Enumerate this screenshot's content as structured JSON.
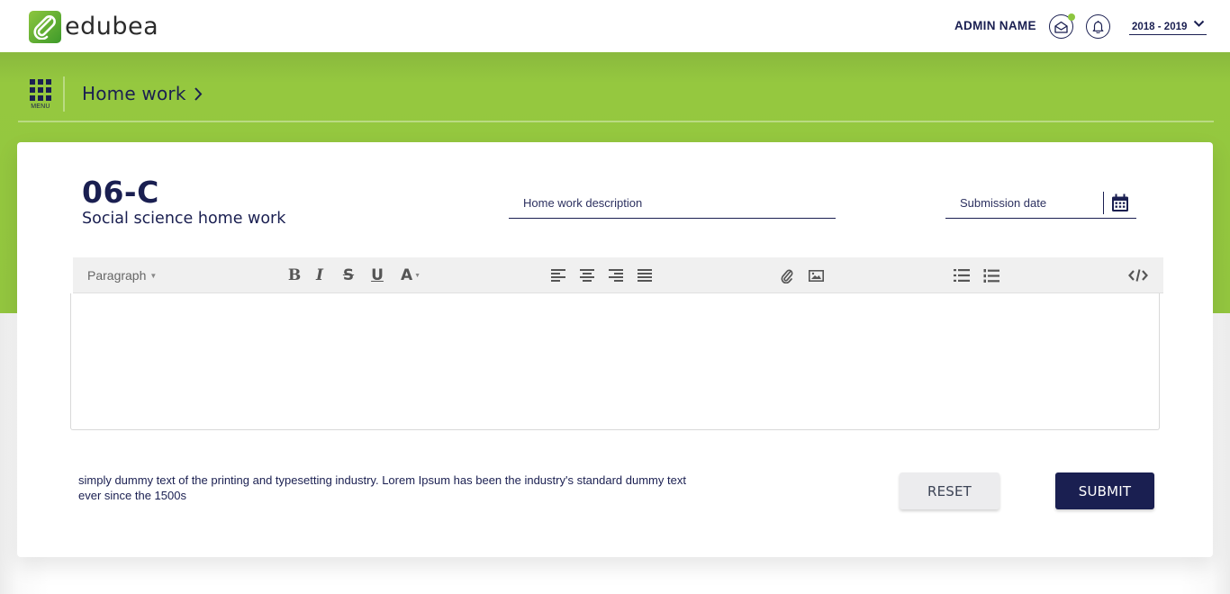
{
  "header": {
    "logo_text": "edubea",
    "admin_name": "ADMIN NAME",
    "icons": {
      "mail": "mail-open-icon",
      "notification": "bell-icon"
    },
    "academic_year": {
      "selected": "2018 - 2019"
    }
  },
  "nav": {
    "menu_label": "MENU",
    "breadcrumb": "Home work"
  },
  "homework": {
    "class_code": "06-C",
    "subject_title": "Social science home work",
    "description_placeholder": "Home work description",
    "submission_date_placeholder": "Submission date"
  },
  "editor": {
    "paragraph_label": "Paragraph",
    "toolbar": {
      "bold": "B",
      "italic": "I",
      "strike": "S",
      "underline": "U",
      "font_color": "A"
    },
    "content": ""
  },
  "footer": {
    "note": "simply dummy text of the printing and typesetting industry. Lorem Ipsum has been the industry's standard dummy text ever since the 1500s",
    "reset_label": "RESET",
    "submit_label": "SUBMIT"
  },
  "colors": {
    "brand_green": "#93c63f",
    "navy": "#1a1f51",
    "notification_dot": "#8dc63f"
  }
}
